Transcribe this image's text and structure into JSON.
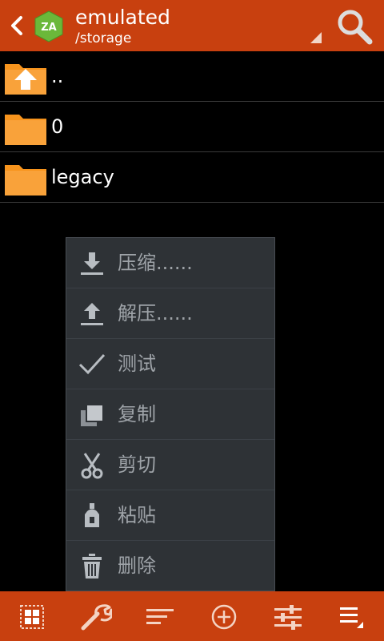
{
  "header": {
    "title": "emulated",
    "path": "/storage",
    "logo_text": "ZA"
  },
  "files": [
    {
      "name": "..",
      "icon": "folder-up-icon"
    },
    {
      "name": "0",
      "icon": "folder-icon"
    },
    {
      "name": "legacy",
      "icon": "folder-icon"
    }
  ],
  "menu": {
    "items": [
      {
        "label": "压缩......",
        "icon": "compress-icon"
      },
      {
        "label": "解压......",
        "icon": "extract-icon"
      },
      {
        "label": "测试",
        "icon": "check-icon"
      },
      {
        "label": "复制",
        "icon": "copy-icon"
      },
      {
        "label": "剪切",
        "icon": "scissors-icon"
      },
      {
        "label": "粘贴",
        "icon": "paste-icon"
      },
      {
        "label": "删除",
        "icon": "trash-icon"
      }
    ]
  },
  "toolbar": {
    "buttons": [
      "select-grid-icon",
      "tools-icon",
      "sort-icon",
      "add-icon",
      "settings-icon",
      "menu-icon"
    ]
  },
  "colors": {
    "accent": "#c8400f",
    "folder": "#f7941d",
    "menu_bg": "#2e3236",
    "menu_text": "#9ea3a8"
  }
}
